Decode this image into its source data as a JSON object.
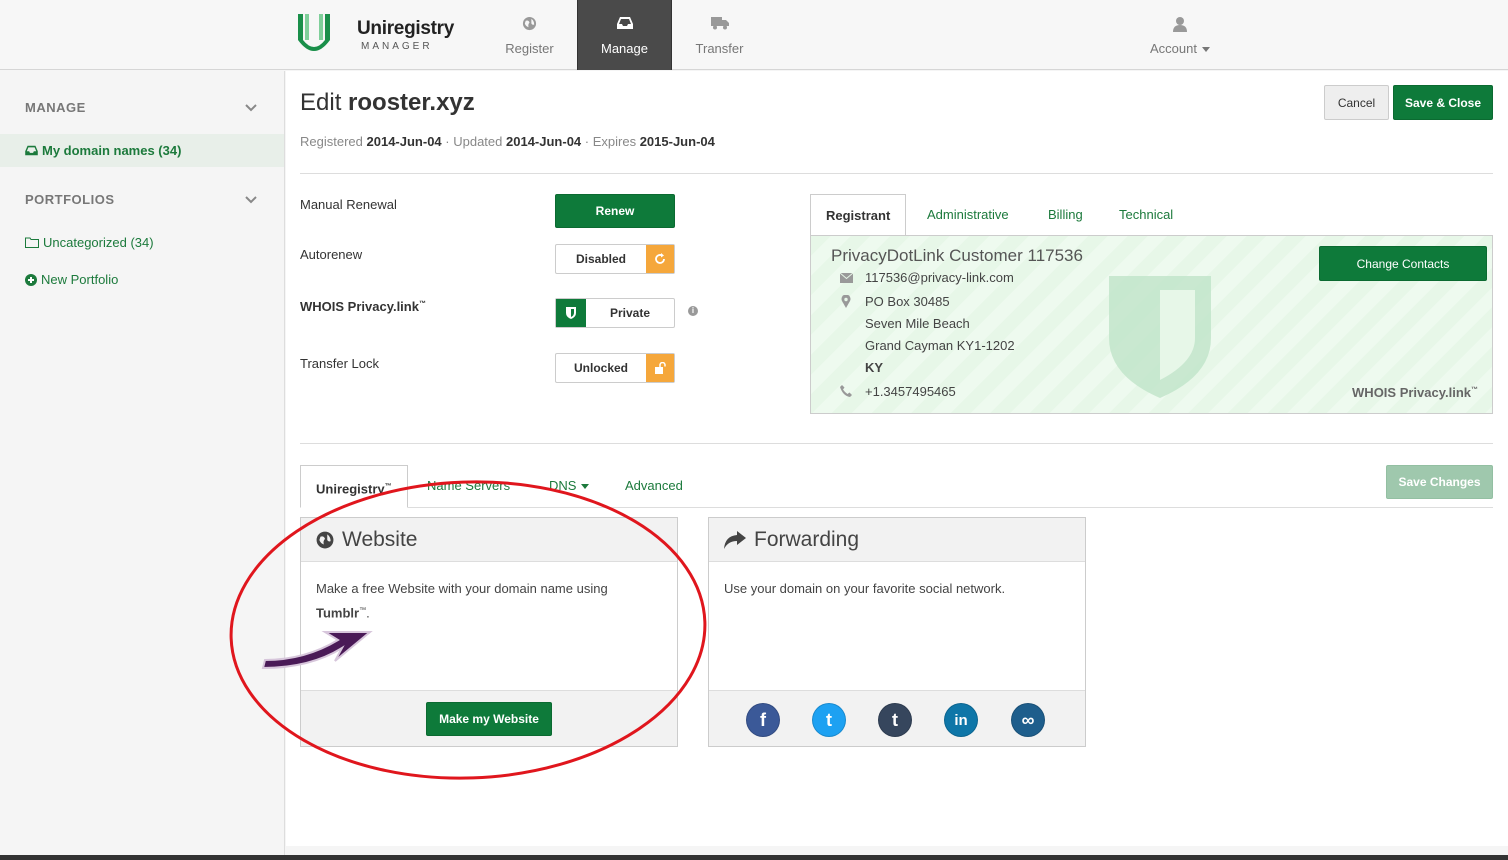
{
  "header": {
    "brand_name": "Uniregistry",
    "brand_sub": "MANAGER",
    "nav": [
      {
        "label": "Register",
        "icon": "globe-icon"
      },
      {
        "label": "Manage",
        "icon": "inbox-icon"
      },
      {
        "label": "Transfer",
        "icon": "truck-icon"
      }
    ],
    "account_label": "Account"
  },
  "sidebar": {
    "manage_heading": "MANAGE",
    "my_domains": "My domain names (34)",
    "portfolios_heading": "PORTFOLIOS",
    "uncategorized": "Uncategorized (34)",
    "new_portfolio": "New Portfolio"
  },
  "page": {
    "title_prefix": "Edit",
    "domain": "rooster.xyz",
    "registered_label": "Registered",
    "registered": "2014-Jun-04",
    "updated_label": "· Updated",
    "updated": "2014-Jun-04",
    "expires_label": "· Expires",
    "expires": "2015-Jun-04",
    "cancel": "Cancel",
    "save_close": "Save & Close"
  },
  "settings": {
    "manual_renewal": "Manual Renewal",
    "renew": "Renew",
    "autorenew": "Autorenew",
    "autorenew_value": "Disabled",
    "whois_privacy": "WHOIS Privacy.link",
    "whois_value": "Private",
    "transfer_lock": "Transfer Lock",
    "transfer_value": "Unlocked",
    "info": "i"
  },
  "contacts": {
    "tabs": [
      "Registrant",
      "Administrative",
      "Billing",
      "Technical"
    ],
    "change_contacts": "Change Contacts",
    "name": "PrivacyDotLink Customer 117536",
    "email": "117536@privacy-link.com",
    "address1": "PO Box 30485",
    "address2": "Seven Mile Beach",
    "address3": "Grand Cayman KY1-1202",
    "country": "KY",
    "phone": "+1.3457495465",
    "whois_logo": "WHOIS Privacy.link"
  },
  "lower_tabs": {
    "uniregistry": "Uniregistry",
    "name_servers": "Name Servers",
    "dns": "DNS",
    "advanced": "Advanced",
    "save_changes": "Save Changes"
  },
  "website_card": {
    "title": "Website",
    "body": "Make a free Website with your domain name using",
    "tumblr": "Tumblr",
    "button": "Make my Website"
  },
  "forwarding_card": {
    "title": "Forwarding",
    "body": "Use your domain on your favorite social network.",
    "social": [
      {
        "icon": "facebook-icon",
        "glyph": "f",
        "color": "#3b5998"
      },
      {
        "icon": "twitter-icon",
        "glyph": "t",
        "color": "#1da1f2"
      },
      {
        "icon": "tumblr-icon",
        "glyph": "t",
        "color": "#36465d"
      },
      {
        "icon": "linkedin-icon",
        "glyph": "in",
        "color": "#0e76a8"
      },
      {
        "icon": "link-icon",
        "glyph": "∞",
        "color": "#1e5e8c"
      }
    ]
  },
  "colors": {
    "brand_green": "#0e7a3a",
    "annotation_red": "#e0161d",
    "annotation_arrow": "#4a1a57"
  }
}
